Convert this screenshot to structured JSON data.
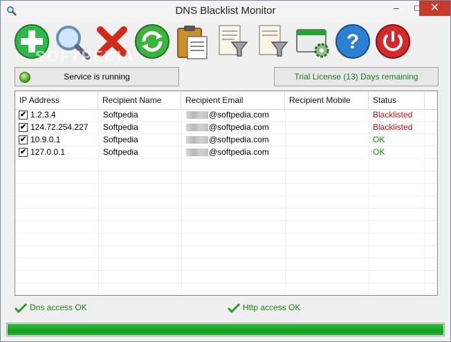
{
  "window": {
    "title": "DNS Blacklist Monitor",
    "minimize_label": "–",
    "maximize_label": "□",
    "close_label": "✕"
  },
  "toolbar": {
    "watermark": "SOFTPEDIA",
    "buttons": [
      "add-icon",
      "search-icon",
      "delete-icon",
      "refresh-icon",
      "clipboard-icon",
      "filter-icon",
      "filter2-icon",
      "settings-icon",
      "help-icon",
      "power-icon"
    ]
  },
  "status": {
    "service": "Service is running",
    "license": "Trial License (13) Days remaining"
  },
  "grid": {
    "columns": [
      "IP Address",
      "Recipient Name",
      "Recipient Email",
      "Recipient Mobile",
      "Status"
    ],
    "rows": [
      {
        "checked": "✔",
        "ip": "1.2.3.4",
        "name": "Softpedia",
        "email": "@softpedia.com",
        "mobile": "",
        "status": "Blacklisted"
      },
      {
        "checked": "✔",
        "ip": "124.72.254.227",
        "name": "Softpedia",
        "email": "@softpedia.com",
        "mobile": "",
        "status": "Blacklisted"
      },
      {
        "checked": "✔",
        "ip": "10.9.0.1",
        "name": "Softpedia",
        "email": "@softpedia.com",
        "mobile": "",
        "status": "OK"
      },
      {
        "checked": "✔",
        "ip": "127.0.0.1",
        "name": "Softpedia",
        "email": "@softpedia.com",
        "mobile": "",
        "status": "OK"
      }
    ]
  },
  "footer": {
    "dns": "Dns access OK",
    "http": "Http access OK"
  },
  "progress": {
    "fraction": 1.0
  },
  "colors": {
    "ok": "#1a8a1a",
    "blacklisted": "#d01010",
    "progress": "#14a020"
  }
}
